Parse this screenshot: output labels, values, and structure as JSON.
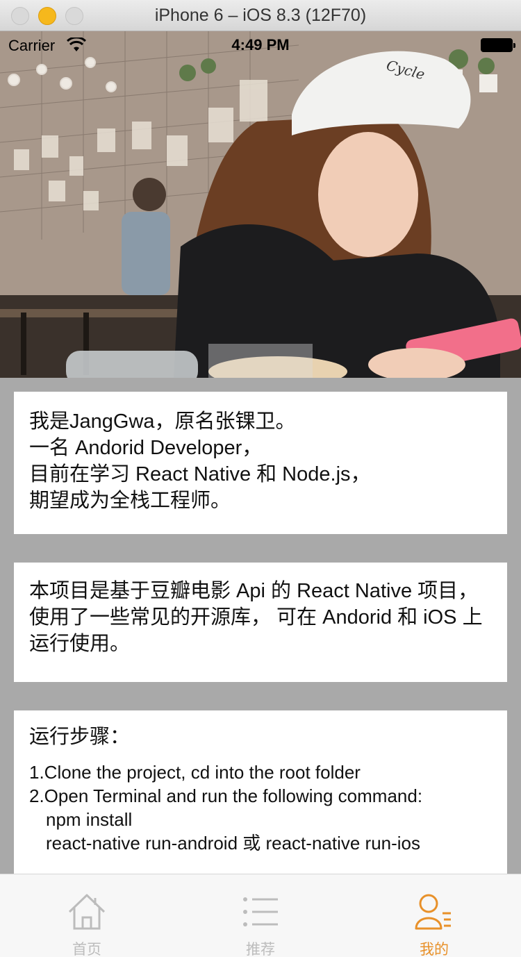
{
  "window": {
    "title": "iPhone 6 – iOS 8.3 (12F70)"
  },
  "status_bar": {
    "carrier": "Carrier",
    "time": "4:49 PM"
  },
  "hero": {
    "cap_text": "Cycle"
  },
  "intro_card": {
    "lines": [
      "我是JangGwa，原名张锞卫。",
      "一名 Andorid Developer，",
      "目前在学习 React Native 和 Node.js，",
      "期望成为全栈工程师。"
    ]
  },
  "project_card": {
    "text": "本项目是基于豆瓣电影 Api 的 React Native 项目， 使用了一些常见的开源库， 可在 Andorid 和 iOS 上运行使用。"
  },
  "steps_card": {
    "title": "运行步骤：",
    "lines": [
      "1.Clone the project, cd into the root folder",
      "2.Open Terminal and run the following command:",
      "npm install",
      "react-native run-android 或 react-native run-ios"
    ]
  },
  "tabs": [
    {
      "label": "首页",
      "icon": "home-icon",
      "active": false
    },
    {
      "label": "推荐",
      "icon": "list-icon",
      "active": false
    },
    {
      "label": "我的",
      "icon": "profile-icon",
      "active": true
    }
  ],
  "colors": {
    "accent": "#e8912a",
    "inactive": "#bcbcbc",
    "page_bg": "#a9a9a9"
  }
}
